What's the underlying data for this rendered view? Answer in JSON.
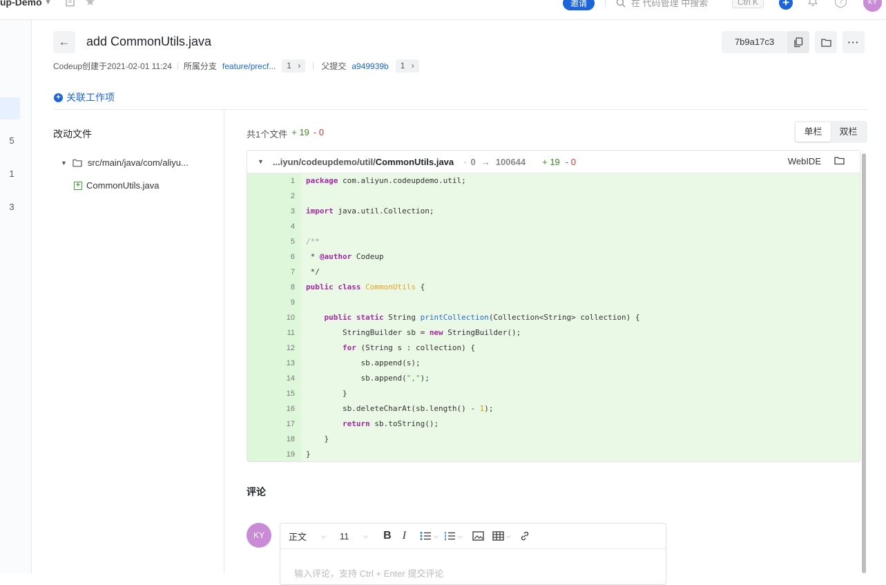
{
  "topbar": {
    "project": "up-Demo",
    "invite": "邀请",
    "search_placeholder": "在 代码管理 中搜索",
    "shortcut": "Ctrl K",
    "avatar": "KY"
  },
  "rail": {
    "numbers": [
      "5",
      "1",
      "3"
    ]
  },
  "commit": {
    "title": "add CommonUtils.java",
    "hash": "7b9a17c3",
    "author_created": "Codeup创建于2021-02-01 11:24",
    "branch_label": "所属分支",
    "branch": "feature/precf...",
    "branch_count": "1",
    "parent_label": "父提交",
    "parent": "a949939b",
    "parent_count": "1",
    "link_work": "关联工作项"
  },
  "files_panel": {
    "title": "改动文件",
    "dir": "src/main/java/com/aliyu...",
    "file": "CommonUtils.java"
  },
  "diff": {
    "summary": "共1个文件",
    "added": "+ 19",
    "removed": "- 0",
    "view_single": "单栏",
    "view_double": "双栏",
    "path_prefix": "...iyun/codeupdemo/util/",
    "file_name": "CommonUtils.java",
    "mode_from": "0",
    "mode_to": "100644",
    "file_added": "+ 19",
    "file_removed": "- 0",
    "webide": "WebIDE",
    "lines": [
      "1",
      "2",
      "3",
      "4",
      "5",
      "6",
      "7",
      "8",
      "9",
      "10",
      "11",
      "12",
      "13",
      "14",
      "15",
      "16",
      "17",
      "18",
      "19"
    ]
  },
  "comments": {
    "title": "评论",
    "avatar": "KY",
    "style": "正文",
    "size": "11",
    "placeholder": "输入评论，支持 Ctrl + Enter 提交评论"
  }
}
